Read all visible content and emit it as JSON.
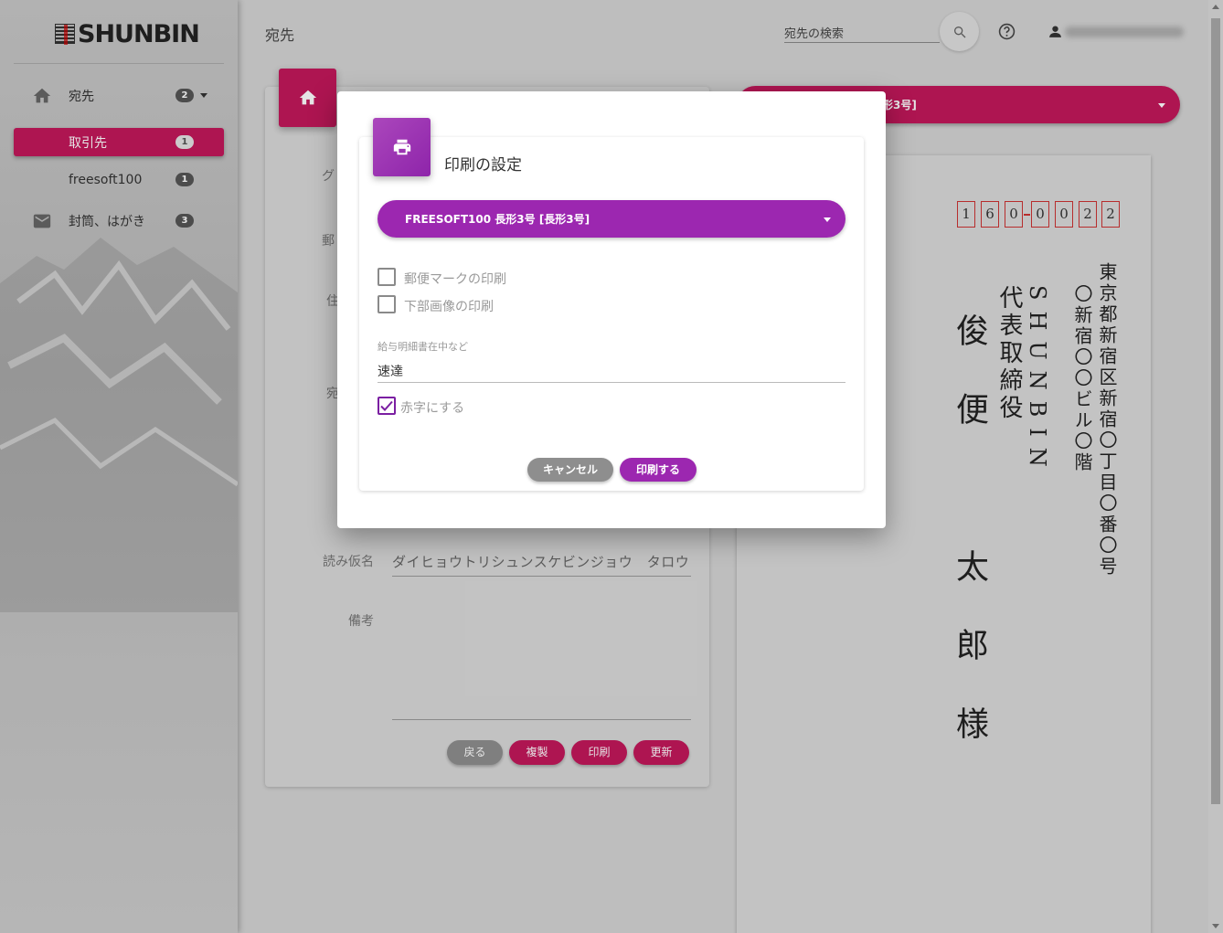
{
  "app": {
    "logo_text": "SHUNBIN"
  },
  "sidebar": {
    "items": [
      {
        "label": "宛先",
        "badge": "2",
        "icon": "home-icon"
      },
      {
        "label": "取引先",
        "badge": "1",
        "active": true
      },
      {
        "label": "freesoft100",
        "badge": "1"
      },
      {
        "label": "封筒、はがき",
        "badge": "3",
        "icon": "mail-icon"
      }
    ]
  },
  "header": {
    "title": "宛先",
    "search_value": "宛先の検索",
    "icons": [
      "search-icon",
      "help-icon",
      "user-icon"
    ]
  },
  "form": {
    "labels": {
      "group": "グ",
      "postal": "郵",
      "address": "住",
      "recipient": "宛",
      "yomi": "読み仮名",
      "notes": "備考"
    },
    "yomi_value": "ダイヒョウトリシュンスケビンジョウ　タロウ　サ",
    "buttons": {
      "back": "戻る",
      "duplicate": "複製",
      "print": "印刷",
      "update": "更新"
    }
  },
  "preview": {
    "envelope_select": "長形3号]",
    "postal_code": [
      "1",
      "6",
      "0",
      "0",
      "0",
      "2",
      "2"
    ],
    "address_line1": "東京都新宿区新宿〇丁目〇番〇号",
    "address_line2": "〇新宿〇〇ビル〇階",
    "company": "SHUNBIN",
    "title": "代表取締役",
    "name": "俊便　太郎様"
  },
  "dialog": {
    "title": "印刷の設定",
    "envelope_select": "FREESOFT100 長形3号 [長形3号]",
    "checkbox_stamp": {
      "label": "郵便マークの印刷",
      "checked": false
    },
    "checkbox_bottom_image": {
      "label": "下部画像の印刷",
      "checked": false
    },
    "note_field": {
      "label": "給与明細書在中など",
      "value": "速達"
    },
    "checkbox_red": {
      "label": "赤字にする",
      "checked": true
    },
    "buttons": {
      "cancel": "キャンセル",
      "print": "印刷する"
    }
  },
  "colors": {
    "accent": "#c2185b",
    "dialog_accent": "#9c27b0",
    "zip_box": "#cc3333"
  }
}
